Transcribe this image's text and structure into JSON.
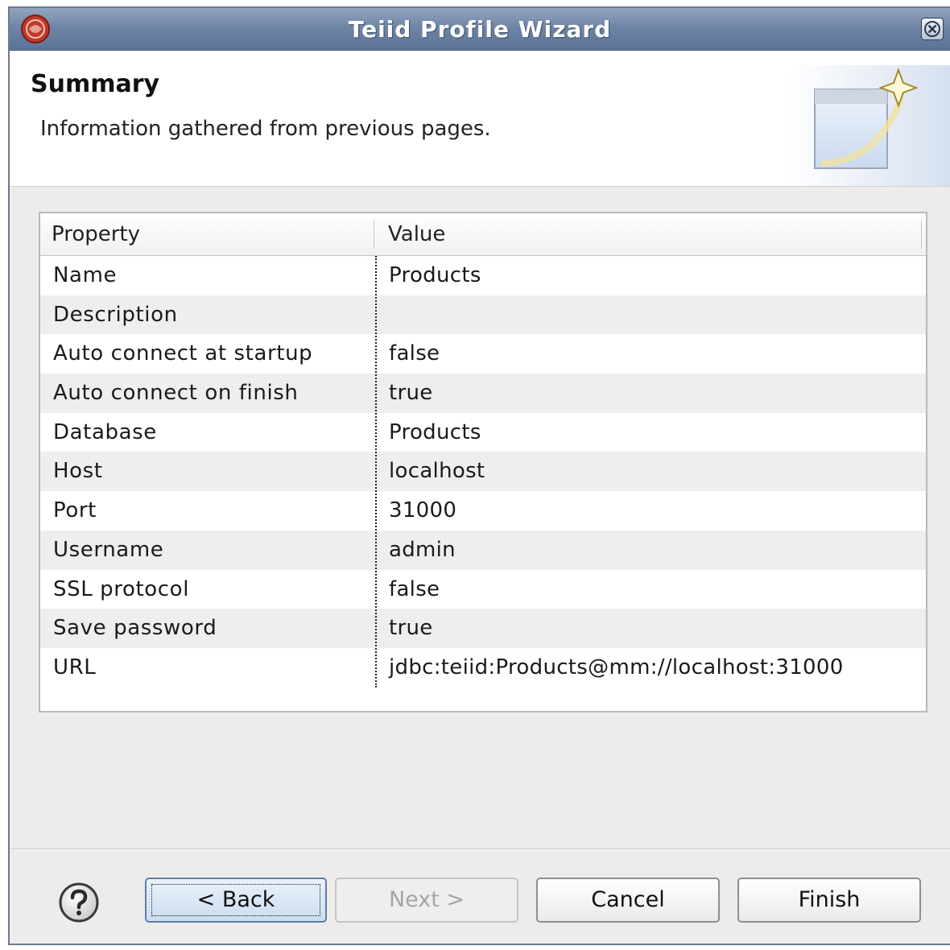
{
  "window": {
    "title": "Teiid Profile Wizard"
  },
  "header": {
    "title": "Summary",
    "description": "Information gathered from previous pages."
  },
  "table": {
    "columns": [
      "Property",
      "Value"
    ],
    "rows": [
      {
        "property": "Name",
        "value": "Products"
      },
      {
        "property": "Description",
        "value": ""
      },
      {
        "property": "Auto connect at startup",
        "value": "false"
      },
      {
        "property": "Auto connect on finish",
        "value": "true"
      },
      {
        "property": "Database",
        "value": "Products"
      },
      {
        "property": "Host",
        "value": "localhost"
      },
      {
        "property": "Port",
        "value": "31000"
      },
      {
        "property": "Username",
        "value": "admin"
      },
      {
        "property": "SSL protocol",
        "value": "false"
      },
      {
        "property": "Save password",
        "value": "true"
      },
      {
        "property": "URL",
        "value": "jdbc:teiid:Products@mm://localhost:31000"
      }
    ]
  },
  "buttons": {
    "back": "< Back",
    "next": "Next >",
    "cancel": "Cancel",
    "finish": "Finish"
  },
  "icons": {
    "app": "eclipse-teiid-icon",
    "close": "close-icon",
    "help": "help-icon",
    "banner": "wizard-banner-icon"
  },
  "colors": {
    "titlebar": "#6f85a6",
    "dialog_bg": "#edeceb",
    "focus_button": "#cbdcee"
  }
}
